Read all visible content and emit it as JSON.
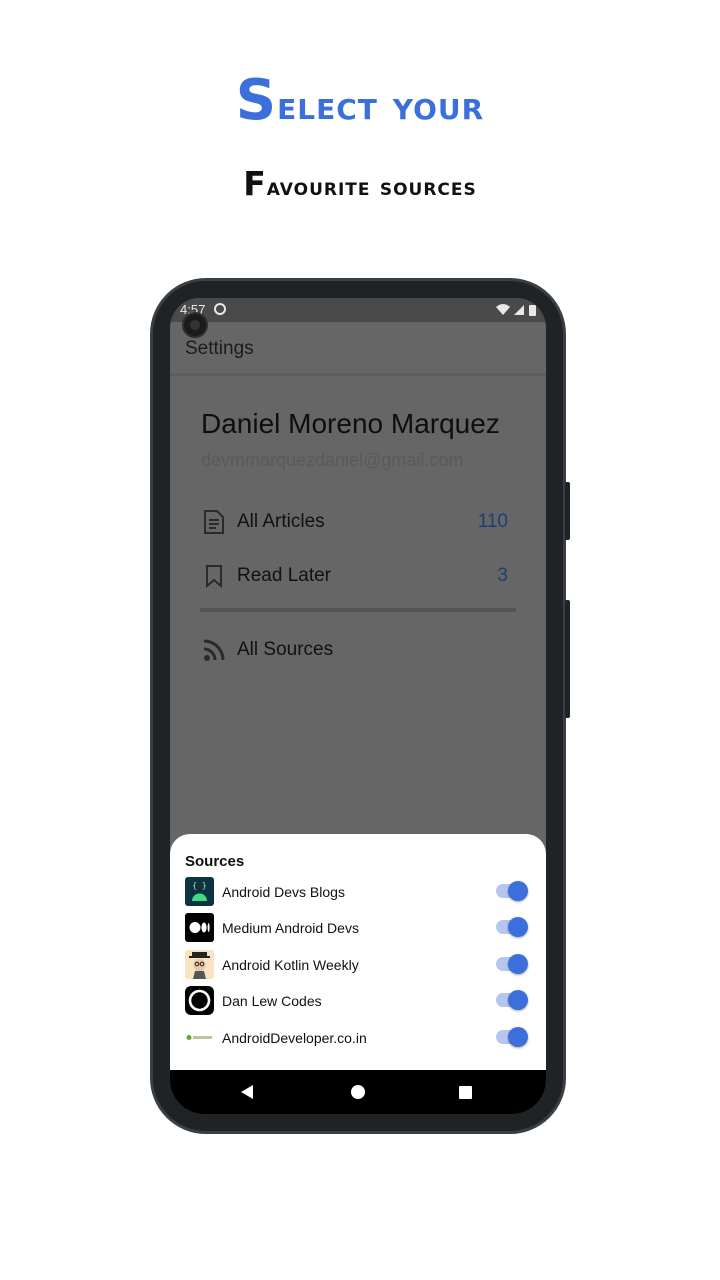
{
  "headline": {
    "line1_first": "S",
    "line1_rest": "elect your",
    "line2_first": "F",
    "line2_rest": "avourite  sources"
  },
  "status_bar": {
    "time": "4:57"
  },
  "appbar": {
    "title": "Settings"
  },
  "profile": {
    "name": "Daniel Moreno Marquez",
    "email": "devmmarquezdaniel@gmail.com"
  },
  "menu": [
    {
      "label": "All Articles",
      "count": "110",
      "icon": "article-icon"
    },
    {
      "label": "Read Later",
      "count": "3",
      "icon": "bookmark-icon"
    },
    {
      "label": "All Sources",
      "icon": "rss-icon"
    }
  ],
  "sources_sheet": {
    "title": "Sources",
    "items": [
      {
        "name": "Android Devs Blogs",
        "enabled": true,
        "logo": "android-devs-logo"
      },
      {
        "name": "Medium Android Devs",
        "enabled": true,
        "logo": "medium-logo"
      },
      {
        "name": "Android Kotlin Weekly",
        "enabled": true,
        "logo": "kotlin-weekly-logo"
      },
      {
        "name": "Dan Lew Codes",
        "enabled": true,
        "logo": "dan-lew-logo"
      },
      {
        "name": "AndroidDeveloper.co.in",
        "enabled": true,
        "logo": "androiddeveloper-logo"
      }
    ]
  },
  "colors": {
    "accent": "#3a6fdc",
    "count": "#1f3d75",
    "scrim": "#666666"
  }
}
